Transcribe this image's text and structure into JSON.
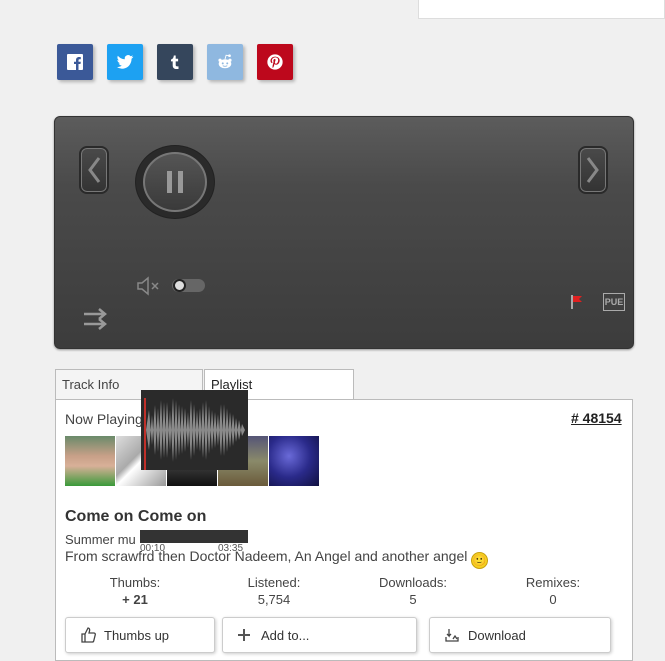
{
  "share": {
    "facebook_color": "#3b5998",
    "twitter_color": "#1da1f2",
    "tumblr_color": "#35465c",
    "reddit_color": "#8fb8e0",
    "pinterest_color": "#bd081c"
  },
  "player": {
    "pub_label": "PUE"
  },
  "tabs": {
    "track_info": "Track Info",
    "playlist": "Playlist"
  },
  "track": {
    "now_playing": "Now Playing",
    "id_link": "# 48154",
    "title": "Come on Come on",
    "line1": "Summer mu",
    "time_elapsed": "00:10",
    "time_total": "03:35",
    "line2": "From scrawfrd then Doctor Nadeem, An Angel and another angel",
    "emoji": "🙂"
  },
  "stats": {
    "thumbs_label": "Thumbs:",
    "thumbs_value": "+ 21",
    "listened_label": "Listened:",
    "listened_value": "5,754",
    "downloads_label": "Downloads:",
    "downloads_value": "5",
    "remixes_label": "Remixes:",
    "remixes_value": "0"
  },
  "actions": {
    "thumbs_up": "Thumbs up",
    "add_to": "Add to...",
    "download": "Download"
  }
}
